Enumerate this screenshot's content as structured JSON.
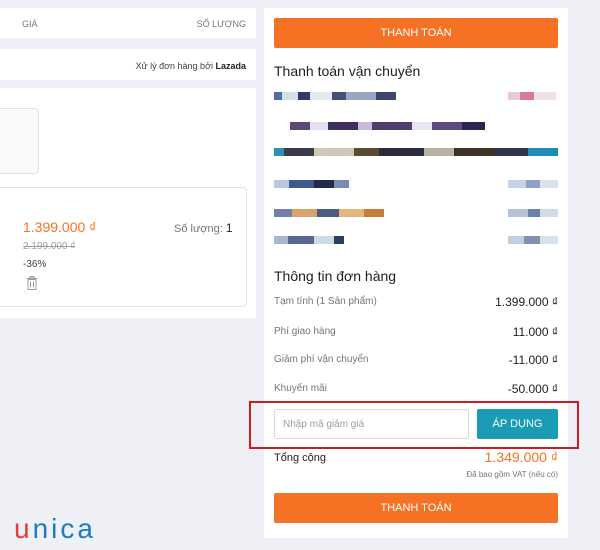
{
  "left": {
    "header": {
      "price_col": "GIÁ",
      "qty_col": "SỐ LƯỢNG"
    },
    "shipping": {
      "handled_by": "Xử lý đơn hàng bởi",
      "seller": "Lazada"
    },
    "item": {
      "price": "1.399.000 ₫",
      "old_price": "2.199.000 ₫",
      "discount": "-36%",
      "qty_label": "Số lượng:",
      "qty_value": "1"
    }
  },
  "right": {
    "pay_button": "THANH TOÁN",
    "shipping_title": "Thanh toán vận chuyển",
    "order_title": "Thông tin đơn hàng",
    "rows": [
      {
        "label": "Tạm tính (1 Sản phẩm)",
        "value": "1.399.000 ₫"
      },
      {
        "label": "Phí giao hàng",
        "value": "11.000 ₫"
      },
      {
        "label": "Giảm phí vận chuyển",
        "value": "-11.000 ₫"
      },
      {
        "label": "Khuyến mãi",
        "value": "-50.000 ₫"
      }
    ],
    "voucher": {
      "placeholder": "Nhập mã giảm giá",
      "apply": "ÁP DỤNG"
    },
    "total": {
      "label": "Tổng cộng",
      "value": "1.349.000 ₫",
      "vat_note": "Đã bao gồm VAT (nếu có)"
    },
    "pay_button_bottom": "THANH TOÁN"
  },
  "logo": {
    "first": "u",
    "rest": "nica"
  },
  "colors": {
    "accent": "#f57224",
    "apply": "#1a9cb7",
    "highlight": "#d01c1f"
  }
}
